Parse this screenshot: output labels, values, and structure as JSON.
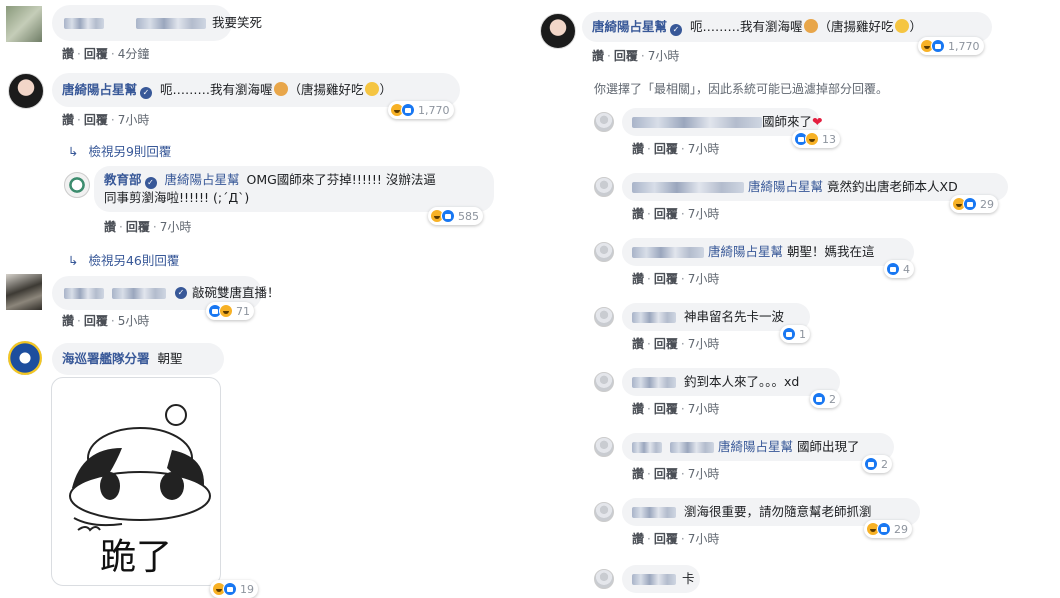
{
  "left": {
    "c1": {
      "text": "我要笑死",
      "reply": "回覆",
      "like": "讚",
      "time": "4分鐘"
    },
    "c2": {
      "name": "唐綺陽占星幫",
      "text_a": "呃………我有瀏海喔",
      "text_b": "（唐揚雞好吃",
      "text_c": "）",
      "reaction_count": "1,770",
      "like": "讚",
      "reply": "回覆",
      "time": "7小時"
    },
    "view_more_1": "檢視另9則回覆",
    "c3": {
      "name": "教育部",
      "tag": "唐綺陽占星幫",
      "text_line1": "OMG國師來了芬掉!!!!!! 沒辦法逼",
      "text_line2": "同事剪瀏海啦!!!!!! (;´Д`)",
      "reaction_count": "585",
      "like": "讚",
      "reply": "回覆",
      "time": "7小時"
    },
    "view_more_2": "檢視另46則回覆",
    "c4": {
      "text": "敲碗雙唐直播！",
      "reaction_count": "71",
      "like": "讚",
      "reply": "回覆",
      "time": "5小時"
    },
    "c5": {
      "name": "海巡署艦隊分署",
      "text": "朝聖",
      "sticker_text": "跪了",
      "reaction_count": "19"
    }
  },
  "right": {
    "main": {
      "name": "唐綺陽占星幫",
      "text_a": "呃………我有瀏海喔",
      "text_b": "（唐揚雞好吃",
      "text_c": "）",
      "reaction_count": "1,770",
      "like": "讚",
      "reply": "回覆",
      "time": "7小時"
    },
    "notice": "你選擇了「最相關」，因此系統可能已過濾掉部分回覆。",
    "replies": [
      {
        "text": "國師來了",
        "reaction_count": "13",
        "like": "讚",
        "reply": "回覆",
        "time": "7小時"
      },
      {
        "tag": "唐綺陽占星幫",
        "text": "竟然釣出唐老師本人XD",
        "reaction_count": "29",
        "like": "讚",
        "reply": "回覆",
        "time": "7小時"
      },
      {
        "tag": "唐綺陽占星幫",
        "text": "朝聖！媽我在這",
        "reaction_count": "4",
        "like": "讚",
        "reply": "回覆",
        "time": "7小時"
      },
      {
        "text": "神串留名先卡一波",
        "reaction_count": "1",
        "like": "讚",
        "reply": "回覆",
        "time": "7小時"
      },
      {
        "text": "釣到本人來了。。。xd",
        "reaction_count": "2",
        "like": "讚",
        "reply": "回覆",
        "time": "7小時"
      },
      {
        "tag": "唐綺陽占星幫",
        "text": "國師出現了",
        "reaction_count": "2",
        "like": "讚",
        "reply": "回覆",
        "time": "7小時"
      },
      {
        "text": "瀏海很重要，請勿隨意幫老師抓瀏",
        "reaction_count": "29",
        "like": "讚",
        "reply": "回覆",
        "time": "7小時"
      },
      {
        "text": "卡"
      }
    ]
  },
  "colors": {
    "link": "#385898",
    "bubble": "#f2f3f5",
    "like": "#1877f2",
    "haha": "#f7b125",
    "heart": "#e41e3f"
  }
}
